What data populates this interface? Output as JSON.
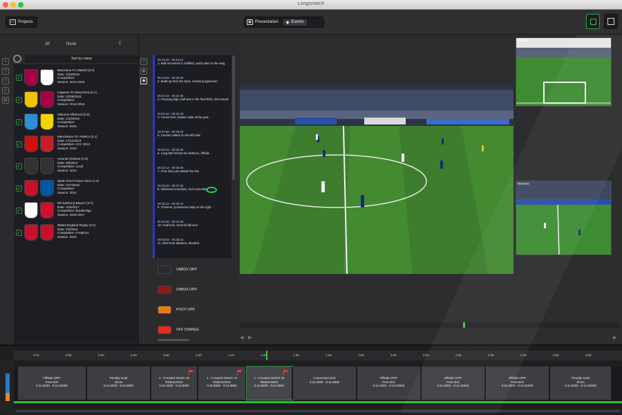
{
  "window": {
    "title": "Longomatch"
  },
  "toolbar": {
    "projects_label": "Projects",
    "presentation_label": "Presentation",
    "events_label": "Events"
  },
  "left_tabs": {
    "all": "All",
    "none": "None"
  },
  "sort_label": "Sort by name",
  "matches": [
    {
      "title": "Barcelona FC-Madrid (3-2)",
      "date": "Date: 1/10/2015",
      "comp": "Competition:",
      "season": "Season: 2014-2015",
      "color_a": "#a50044",
      "color_b": "#ffffff"
    },
    {
      "title": "Leganes FC-Barcelona (4-1)",
      "date": "Date: 22/05/2015",
      "comp": "Competition:",
      "season": "Season: 2014-2015",
      "color_a": "#f2c300",
      "color_b": "#a50044"
    },
    {
      "title": "Valencia-Villarreal (3-0)",
      "date": "Date: 1/10/2015",
      "comp": "Competition:",
      "season": "Season: 2015",
      "color_a": "#2a8fd4",
      "color_b": "#f2d400"
    },
    {
      "title": "Manchester FC-Atletico (2-1)",
      "date": "Date: 17/11/2013",
      "comp": "Competition: ACC 2013",
      "season": "Season: 2013",
      "color_a": "#d01010",
      "color_b": "#c81e2a"
    },
    {
      "title": "Arsenal-Chelsea (2-0)",
      "date": "Date: 3/5/2014",
      "comp": "Competition: Local",
      "season": "Season: 2014",
      "color_a": "#333333",
      "color_b": "#333333"
    },
    {
      "title": "Spain 2014 France 2014 (1-2)",
      "date": "Date: 12/7/2015",
      "comp": "Competition:",
      "season": "Season: 2014",
      "color_a": "#c8102e",
      "color_b": "#0055a4"
    },
    {
      "title": "RB Salzburg-Bayern (2-1)",
      "date": "Date: 11/5/2017",
      "comp": "Competition: Bundesliga",
      "season": "Season: 2016-2017",
      "color_a": "#ffffff",
      "color_b": "#d0102a"
    },
    {
      "title": "Wales-England Rugby (3-2)",
      "date": "Date: 2/3/2015",
      "comp": "Competition: 6 Nations",
      "season": "Season: 2015",
      "color_a": "#c8102e",
      "color_b": "#c8102e"
    }
  ],
  "events": [
    {
      "time": "00:15:40 - 00:16:12",
      "text": "1. Ball recovered in midfield, quick pass to the wing"
    },
    {
      "time": "00:18:05 - 00:18:30",
      "text": "2. Build up from the back, central progression"
    },
    {
      "time": "00:21:22 - 00:21:48",
      "text": "3. Pressing high, ball won in the final third, shot saved"
    },
    {
      "time": "00:24:10 - 00:24:40",
      "text": "4. Corner kick, header wide of the post"
    },
    {
      "time": "00:27:55 - 00:28:20",
      "text": "5. Counter attack on the left side"
    },
    {
      "time": "00:30:01 - 00:30:35",
      "text": "6. Long ball behind the defence, offside"
    },
    {
      "time": "00:33:14 - 00:33:50",
      "text": "7. Free kick just outside the box"
    },
    {
      "time": "00:36:40 - 00:37:05",
      "text": "8. Defensive transition, foul committed"
    },
    {
      "time": "00:39:12 - 00:39:44",
      "text": "9. Throw-in, possession kept on the right"
    },
    {
      "time": "00:42:30 - 00:42:58",
      "text": "10. Goal kick, second ball won"
    },
    {
      "time": "00:45:02 - 00:45:33",
      "text": "11. Shot from distance, blocked"
    }
  ],
  "code_buttons": [
    {
      "label": "UNBOX OPP.",
      "color": "#2a2a2c"
    },
    {
      "label": "UNBOX OPP.",
      "color": "#8a1a1a"
    },
    {
      "label": "PIVOT OPP.",
      "color": "#e87a1a"
    },
    {
      "label": "OFF CHANGE",
      "color": "#e82a1a"
    }
  ],
  "side_videos": {
    "cam1": "Sideline",
    "cam2": "Reverse"
  },
  "ruler_ticks": [
    "0:10",
    "0:20",
    "0:30",
    "0:40",
    "0:50",
    "1:00",
    "1:10",
    "1:20",
    "1:30",
    "1:40",
    "1:50",
    "2:00",
    "2:10",
    "2:20",
    "2:30",
    "2:40",
    "2:50",
    "3:00"
  ],
  "clips": [
    {
      "title": "Offside OPP.",
      "sub": "Free-kick",
      "time": "0:11:2000 - 0:11:22000"
    },
    {
      "title": "Penalty Goal",
      "sub": "Shots",
      "time": "0:11:4000 - 0:11:6000"
    },
    {
      "title": "1 - Forward stretch 15",
      "sub": "REBOUNDS",
      "time": "0:11:4000 - 0:11:5000"
    },
    {
      "title": "1 - Forward stretch 12",
      "sub": "REBOUNDS",
      "time": "0:11:5000 - 0:11:5800"
    },
    {
      "title": "1 - Forward stretch 15",
      "sub": "REBOUNDS",
      "time": "0:11:6000 - 0:11:8000"
    },
    {
      "title": "Conversion Kick",
      "sub": "",
      "time": "0:11:4000 - 0:11:6000"
    },
    {
      "title": "Offside OPP.",
      "sub": "Free-kick",
      "time": "0:11:2000 - 0:11:22000"
    },
    {
      "title": "Offside OPP.",
      "sub": "Free-kick",
      "time": "0:11:2000 - 0:11:22000"
    },
    {
      "title": "Offside OPP.",
      "sub": "Free-kick",
      "time": "0:11:2000 - 0:11:22000"
    },
    {
      "title": "Penalty Goal",
      "sub": "Shots",
      "time": "0:11:2000 - 0:11:22000"
    }
  ],
  "colors": {
    "accent_green": "#2fbf3a",
    "event_bar": "#2a3ac0",
    "pitch": "#3b7a2c"
  }
}
